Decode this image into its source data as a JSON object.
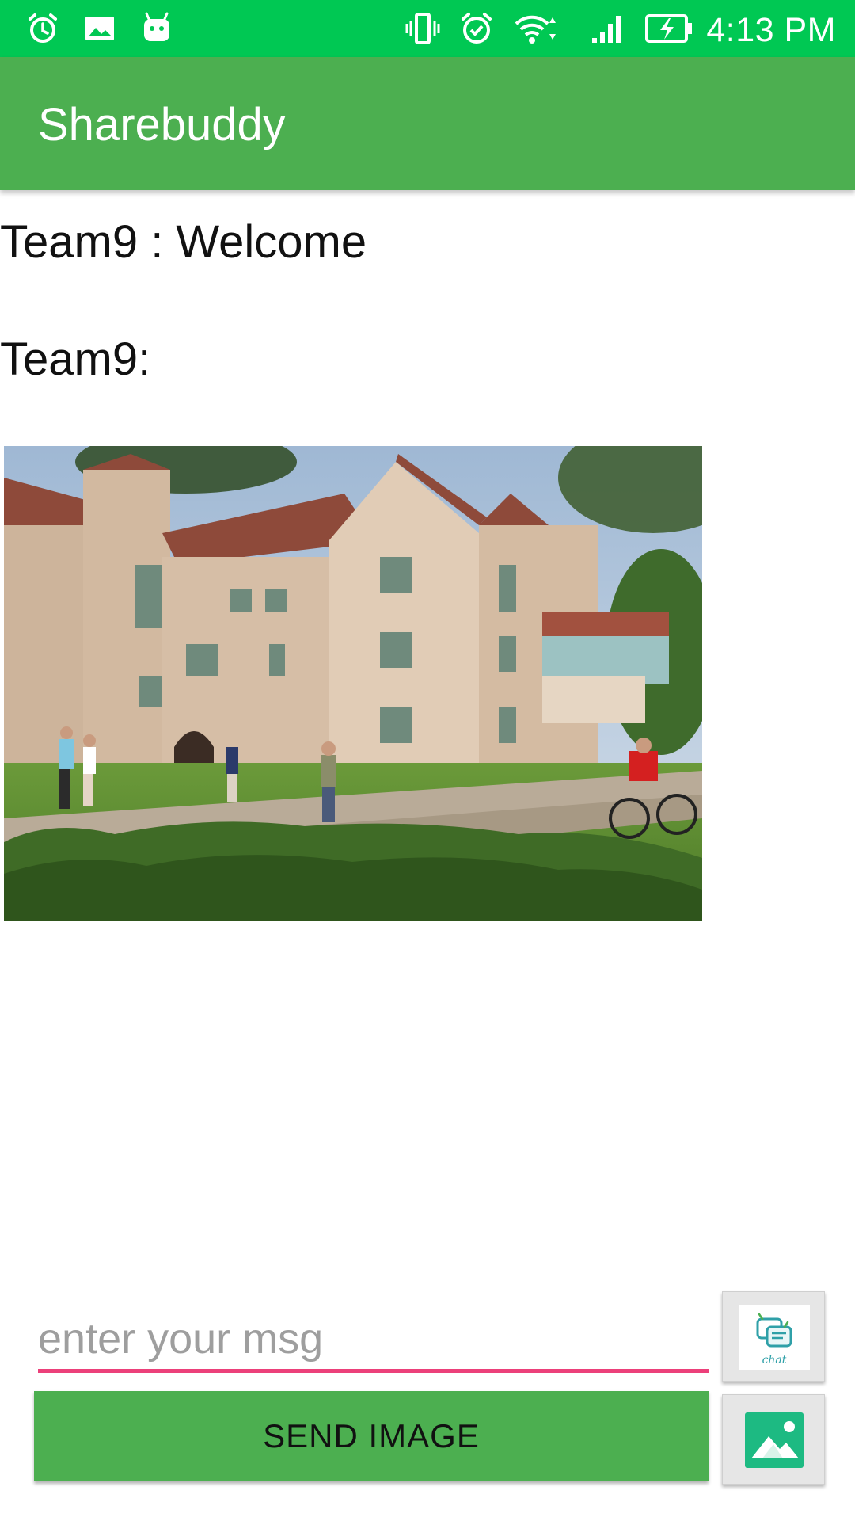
{
  "status_bar": {
    "time": "4:13 PM",
    "icons_left": [
      "alarm-icon",
      "image-icon",
      "android-icon"
    ],
    "icons_right": [
      "vibrate-icon",
      "alarm-clock-icon",
      "wifi-icon",
      "signal-icon",
      "battery-charging-icon"
    ],
    "color": "#00c853"
  },
  "app_bar": {
    "title": "Sharebuddy",
    "color": "#4caf50"
  },
  "messages": [
    {
      "text": "Team9 : Welcome"
    },
    {
      "text": "Team9:"
    }
  ],
  "compose": {
    "placeholder": "enter your msg",
    "value": "",
    "underline_color": "#ec407a",
    "send_image_label": "SEND IMAGE",
    "chat_button_icon": "chat-icon",
    "gallery_button_icon": "gallery-icon"
  }
}
